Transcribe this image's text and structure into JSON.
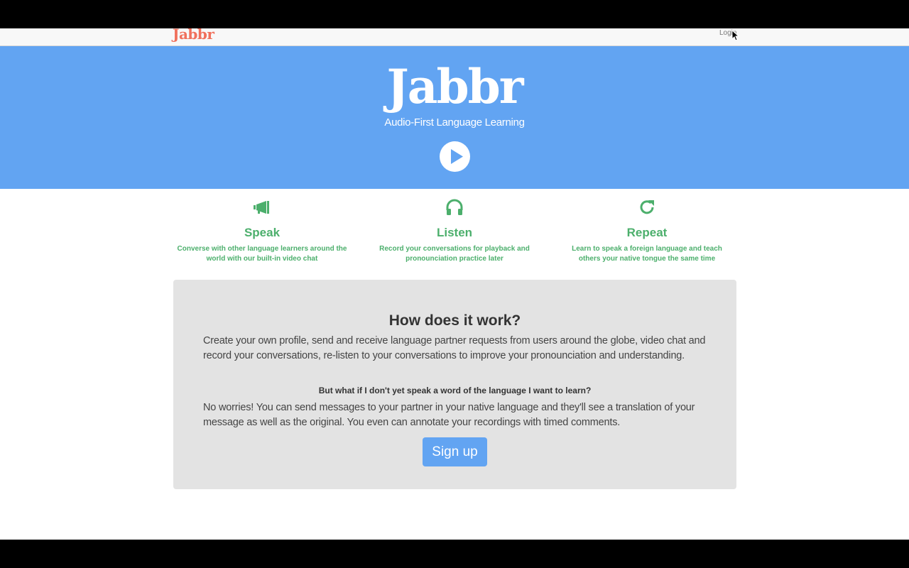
{
  "nav": {
    "brand": "Jabbr",
    "login_label": "Login"
  },
  "hero": {
    "title": "Jabbr",
    "subtitle": "Audio-First Language Learning",
    "play_icon": "play-circle-icon"
  },
  "features": [
    {
      "icon": "megaphone-icon",
      "title": "Speak",
      "text": "Converse with other language learners around the world with our built-in video chat"
    },
    {
      "icon": "headphones-icon",
      "title": "Listen",
      "text": "Record your conversations for playback and pronounciation practice later"
    },
    {
      "icon": "refresh-icon",
      "title": "Repeat",
      "text": "Learn to speak a foreign language and teach others your native tongue the same time"
    }
  ],
  "how": {
    "title": "How does it work?",
    "body": "Create your own profile, send and receive language partner requests from users around the globe, video chat and record your conversations, re-listen to your conversations to improve your pronounciation and understanding.",
    "question": "But what if I don't yet speak a word of the language I want to learn?",
    "answer": "No worries! You can send messages to your partner in your native language and they'll see a translation of your message as well as the original. You even can annotate your recordings with timed comments.",
    "signup_label": "Sign up"
  },
  "colors": {
    "hero_bg": "#62a4f2",
    "brand": "#f0705c",
    "feature_green": "#4caf6c",
    "box_bg": "#e3e3e3"
  }
}
